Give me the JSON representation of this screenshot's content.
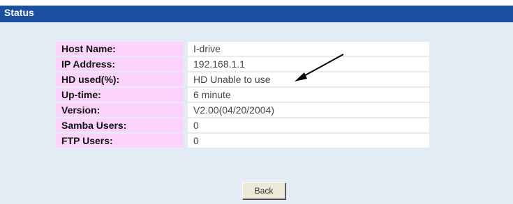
{
  "header": {
    "title": "Status"
  },
  "status_rows": [
    {
      "label": "Host Name:",
      "value": "I-drive"
    },
    {
      "label": "IP Address:",
      "value": "192.168.1.1"
    },
    {
      "label": "HD used(%):",
      "value": "HD Unable to use"
    },
    {
      "label": "Up-time:",
      "value": "6 minute"
    },
    {
      "label": "Version:",
      "value": "V2.00(04/20/2004)"
    },
    {
      "label": "Samba Users:",
      "value": "0"
    },
    {
      "label": "FTP Users:",
      "value": "0"
    }
  ],
  "buttons": {
    "back_label": "Back"
  },
  "colors": {
    "header_bg": "#1b4fa0",
    "panel_bg": "#e3ecf5",
    "label_bg": "#fbd3fb",
    "value_bg": "#ffffff"
  }
}
